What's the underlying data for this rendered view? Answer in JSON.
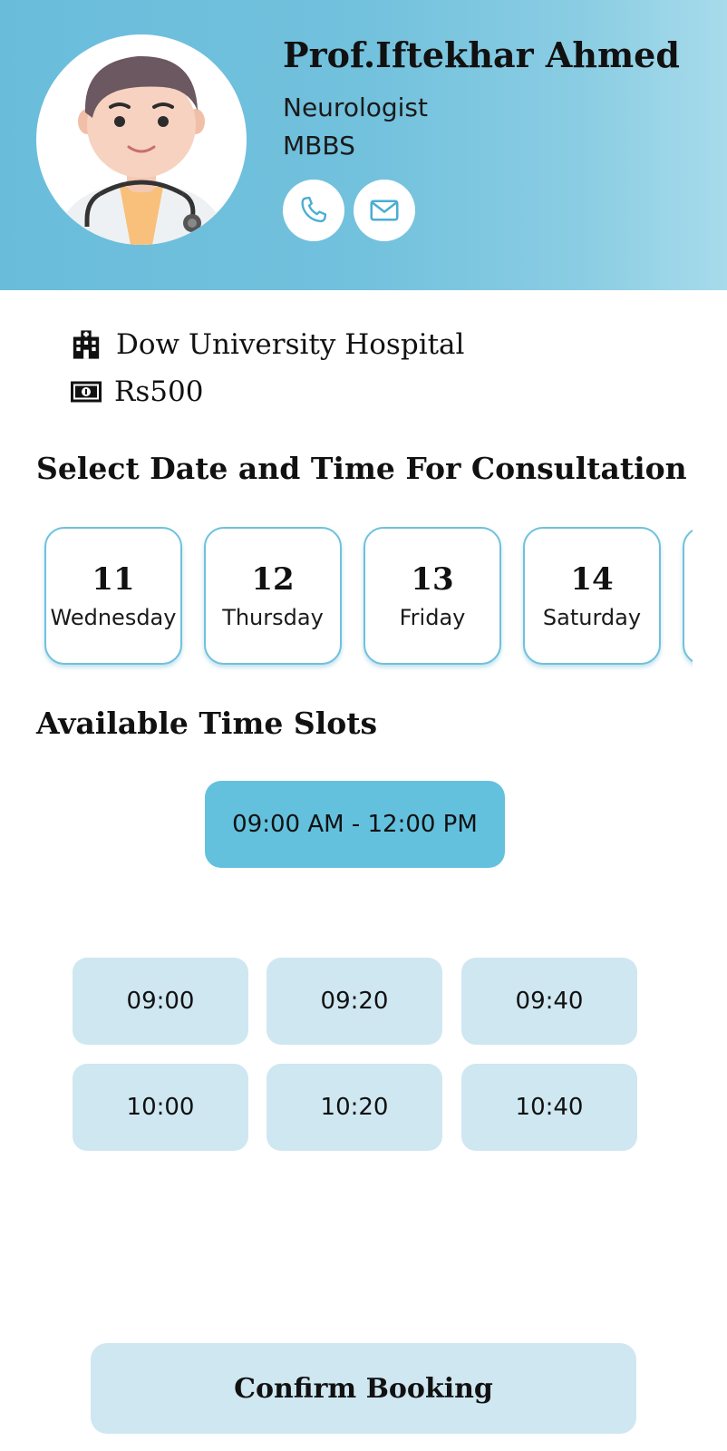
{
  "doctor": {
    "name": "Prof.Iftekhar Ahmed",
    "specialty": "Neurologist",
    "degree": "MBBS",
    "avatar_icon": "doctor-avatar-icon",
    "actions": [
      {
        "icon": "phone-icon"
      },
      {
        "icon": "mail-icon"
      }
    ]
  },
  "info": {
    "hospital": "Dow University Hospital",
    "hospital_icon": "hospital-building-icon",
    "fee": "Rs500",
    "fee_icon": "money-bill-icon"
  },
  "dates_section": {
    "title": "Select Date and Time For Consultation",
    "dates": [
      {
        "num": "11",
        "day": "Wednesday"
      },
      {
        "num": "12",
        "day": "Thursday"
      },
      {
        "num": "13",
        "day": "Friday"
      },
      {
        "num": "14",
        "day": "Saturday"
      }
    ]
  },
  "slots_section": {
    "title": "Available Time Slots",
    "range": "09:00 AM - 12:00 PM",
    "slots": [
      "09:00",
      "09:20",
      "09:40",
      "10:00",
      "10:20",
      "10:40"
    ]
  },
  "confirm_label": "Confirm Booking",
  "colors": {
    "header_start": "#69bddb",
    "header_end": "#a7dbeb",
    "accent": "#63c1de",
    "slot_bg": "#cfe7f1",
    "card_border": "#6fc1dc"
  }
}
